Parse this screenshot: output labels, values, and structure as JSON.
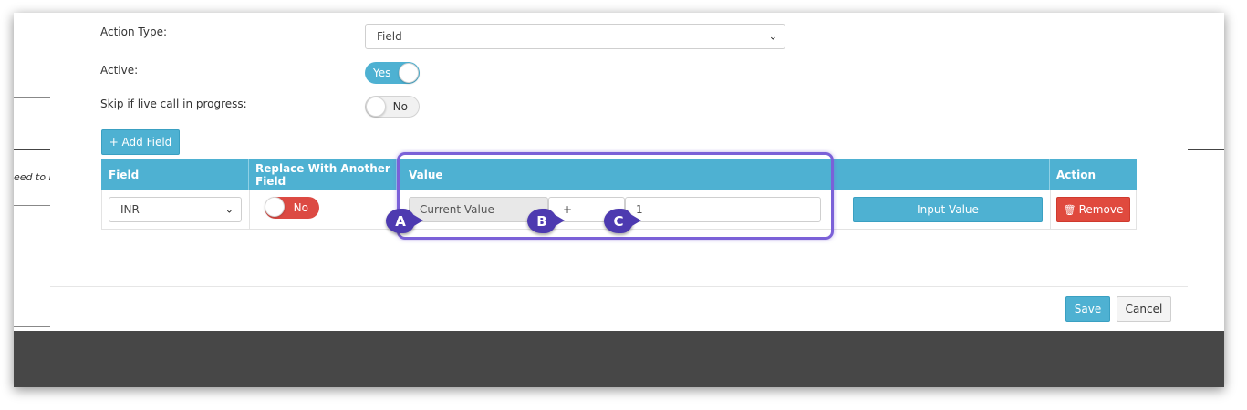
{
  "background": {
    "partial_text": "eed to b"
  },
  "form": {
    "action_type_label": "Action Type:",
    "action_type_value": "Field",
    "active_label": "Active:",
    "active_toggle": "Yes",
    "skip_label": "Skip if live call in progress:",
    "skip_toggle": "No"
  },
  "add_field_button": "+ Add Field",
  "table": {
    "headers": {
      "field": "Field",
      "replace": "Replace With Another Field",
      "value": "Value",
      "action": "Action"
    },
    "row": {
      "field_select": "INR",
      "replace_toggle": "No",
      "current_value": "Current Value",
      "operator": "+",
      "input": "1",
      "input_value_button": "Input Value",
      "remove_button": "Remove"
    }
  },
  "markers": {
    "a": "A",
    "b": "B",
    "c": "C"
  },
  "footer": {
    "save": "Save",
    "cancel": "Cancel"
  },
  "icons": {
    "plus": "plus-icon",
    "trash": "trash-icon",
    "chevron": "chevron-down-icon"
  },
  "colors": {
    "primary": "#4eb1d2",
    "danger": "#e04a3e",
    "highlight": "#7b61d8",
    "marker": "#4d3ab0"
  }
}
